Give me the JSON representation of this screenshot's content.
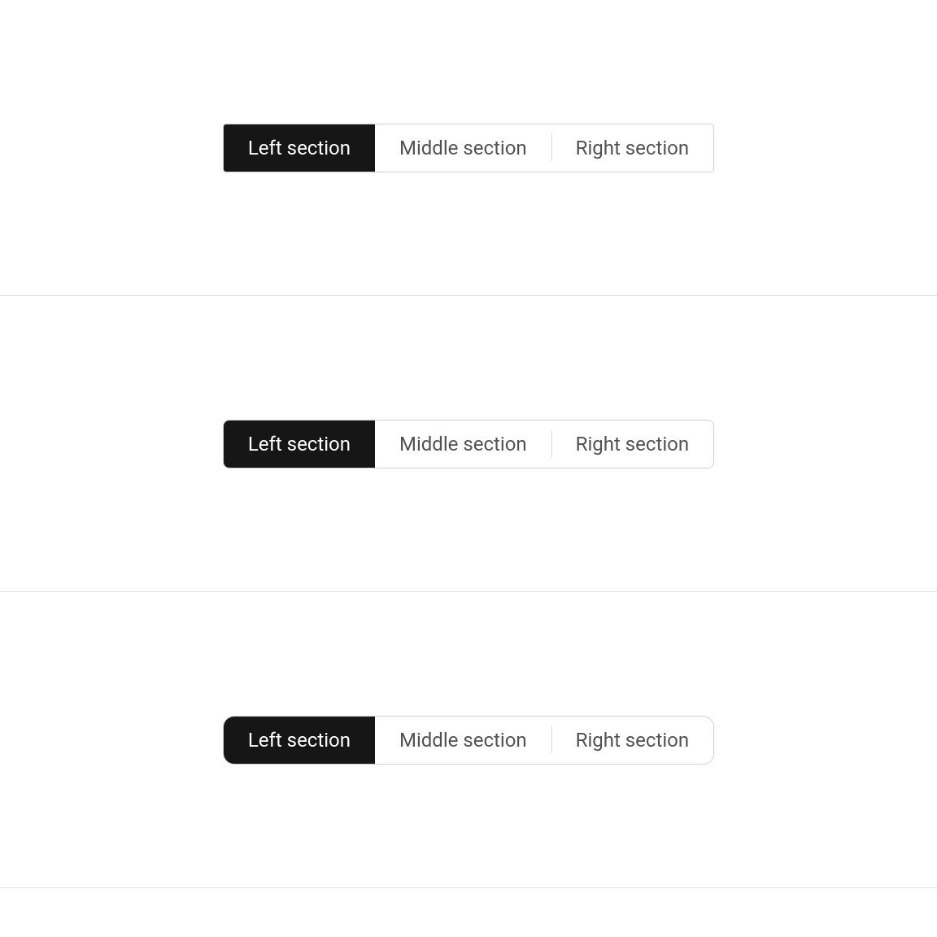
{
  "segmentedControls": [
    {
      "radius": "sc-low",
      "segments": [
        {
          "label": "Left section",
          "selected": true
        },
        {
          "label": "Middle section",
          "selected": false
        },
        {
          "label": "Right section",
          "selected": false
        }
      ]
    },
    {
      "radius": "sc-med",
      "segments": [
        {
          "label": "Left section",
          "selected": true
        },
        {
          "label": "Middle section",
          "selected": false
        },
        {
          "label": "Right section",
          "selected": false
        }
      ]
    },
    {
      "radius": "sc-high",
      "segments": [
        {
          "label": "Left section",
          "selected": true
        },
        {
          "label": "Middle section",
          "selected": false
        },
        {
          "label": "Right section",
          "selected": false
        }
      ]
    }
  ]
}
